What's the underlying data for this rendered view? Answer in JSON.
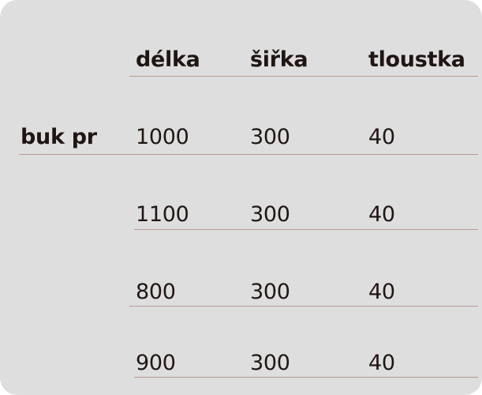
{
  "table": {
    "columns": [
      "délka",
      "šiřka",
      "tloustka"
    ],
    "row_label": "buk pr",
    "rows": [
      [
        "1000",
        "300",
        "40"
      ],
      [
        "1100",
        "300",
        "40"
      ],
      [
        "800",
        "300",
        "40"
      ],
      [
        "900",
        "300",
        "40"
      ]
    ]
  }
}
